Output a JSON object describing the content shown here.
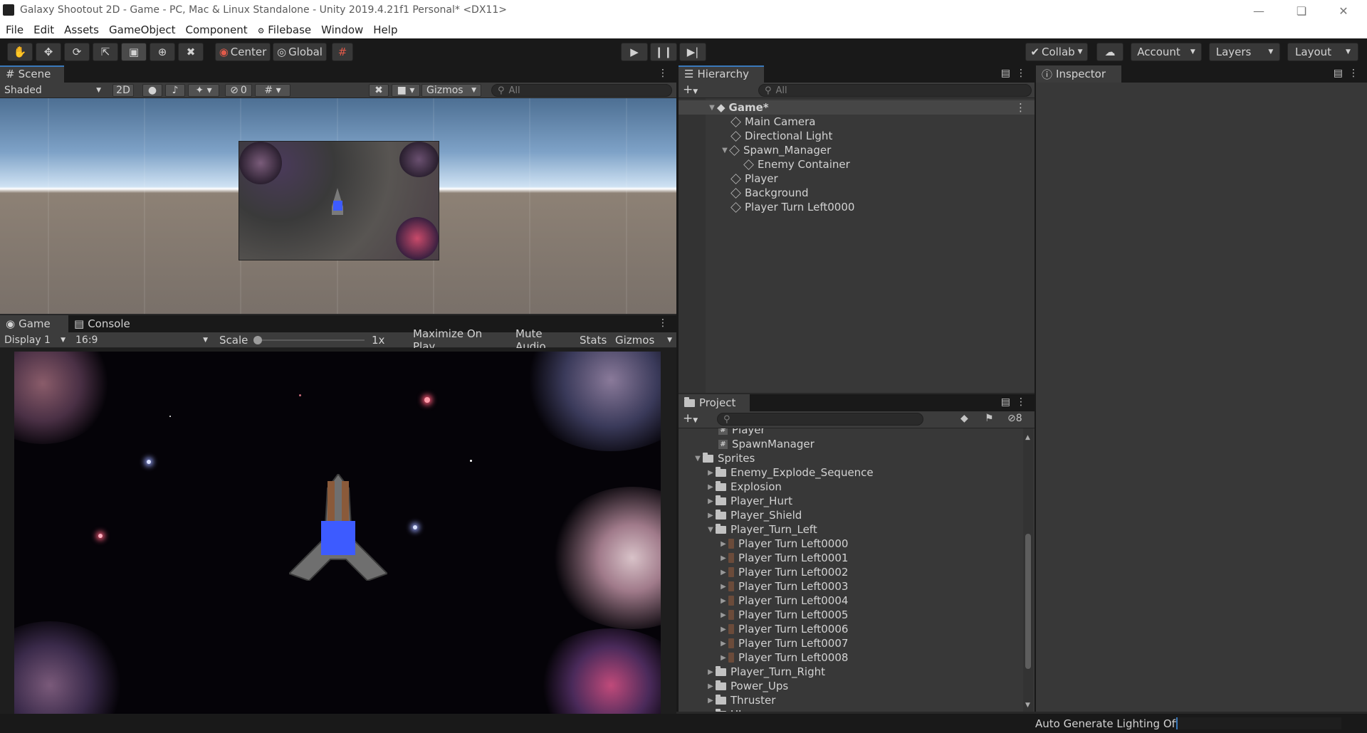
{
  "window": {
    "title": "Galaxy Shootout 2D - Game - PC, Mac & Linux Standalone - Unity 2019.4.21f1 Personal* <DX11>"
  },
  "menu": [
    "File",
    "Edit",
    "Assets",
    "GameObject",
    "Component",
    "Filebase",
    "Window",
    "Help"
  ],
  "toolbar": {
    "pivot_label": "Center",
    "space_label": "Global",
    "collab_label": "Collab",
    "account_label": "Account",
    "layers_label": "Layers",
    "layout_label": "Layout"
  },
  "scene": {
    "tab_label": "Scene",
    "shading": "Shaded",
    "mode_2d": "2D",
    "hidden_count": "0",
    "gizmos_label": "Gizmos",
    "search_placeholder": "All"
  },
  "game": {
    "tab_label": "Game",
    "console_tab_label": "Console",
    "display": "Display 1",
    "aspect": "16:9",
    "scale_label": "Scale",
    "scale_value": "1x",
    "maximize_label": "Maximize On Play",
    "mute_label": "Mute Audio",
    "stats_label": "Stats",
    "gizmos_label": "Gizmos"
  },
  "hierarchy": {
    "tab_label": "Hierarchy",
    "search_placeholder": "All",
    "scene_name": "Game*",
    "items": [
      "Main Camera",
      "Directional Light",
      "Spawn_Manager",
      "Enemy Container",
      "Player",
      "Background",
      "Player Turn Left0000"
    ]
  },
  "inspector": {
    "tab_label": "Inspector"
  },
  "project": {
    "tab_label": "Project",
    "hidden_count": "8",
    "items": [
      "Player",
      "SpawnManager",
      "Sprites",
      "Enemy_Explode_Sequence",
      "Explosion",
      "Player_Hurt",
      "Player_Shield",
      "Player_Turn_Left",
      "Player Turn Left0000",
      "Player Turn Left0001",
      "Player Turn Left0002",
      "Player Turn Left0003",
      "Player Turn Left0004",
      "Player Turn Left0005",
      "Player Turn Left0006",
      "Player Turn Left0007",
      "Player Turn Left0008",
      "Player_Turn_Right",
      "Power_Ups",
      "Thruster",
      "UI"
    ]
  },
  "status": {
    "lighting": "Auto Generate Lighting Off"
  },
  "colors": {
    "accent": "#3a79bb",
    "player_box": "#3d5bff",
    "panel": "#383838"
  }
}
